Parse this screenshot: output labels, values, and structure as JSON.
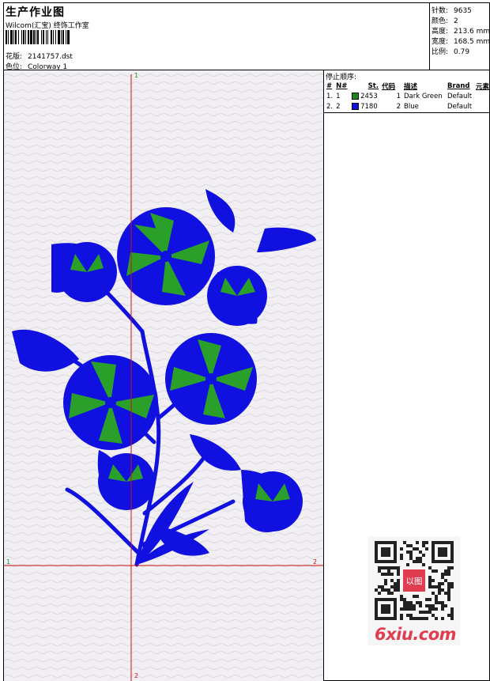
{
  "header": {
    "title": "生产作业图",
    "company": "Wilcom(汇宝) 终饰工作室",
    "design_label": "花版:",
    "design_value": "2141757.dst",
    "colorway_label": "色位:",
    "colorway_value": "Colorway 1"
  },
  "stats": [
    {
      "label": "针数:",
      "value": "9635"
    },
    {
      "label": "颜色:",
      "value": "2"
    },
    {
      "label": "高度:",
      "value": "213.6 mm"
    },
    {
      "label": "宽度:",
      "value": "168.5 mm"
    },
    {
      "label": "比例:",
      "value": "0.79"
    }
  ],
  "stop_sequence": {
    "title": "停止顺序:",
    "columns": [
      "#",
      "N#",
      "St.",
      "代码",
      "描述",
      "Brand",
      "元素"
    ],
    "rows": [
      {
        "num": "1.",
        "needle": "1",
        "color": "#1a8a1a",
        "stitches": "2453",
        "code": "1",
        "desc": "Dark Green",
        "brand": "Default",
        "element": ""
      },
      {
        "num": "2.",
        "needle": "2",
        "color": "#1010e0",
        "stitches": "7180",
        "code": "2",
        "desc": "Blue",
        "brand": "Default",
        "element": ""
      }
    ]
  },
  "axes": {
    "top_label": "1",
    "left_label": "1",
    "right_label": "2",
    "bottom_label": "2"
  },
  "colors": {
    "thread_blue": "#1010e0",
    "thread_green": "#2aa02a",
    "axis_red": "#d01010",
    "axis_label_green": "#10a010",
    "canvas_bg": "#f1eff3"
  },
  "watermark": {
    "badge_text": "以图",
    "site": "6xiu.com"
  }
}
